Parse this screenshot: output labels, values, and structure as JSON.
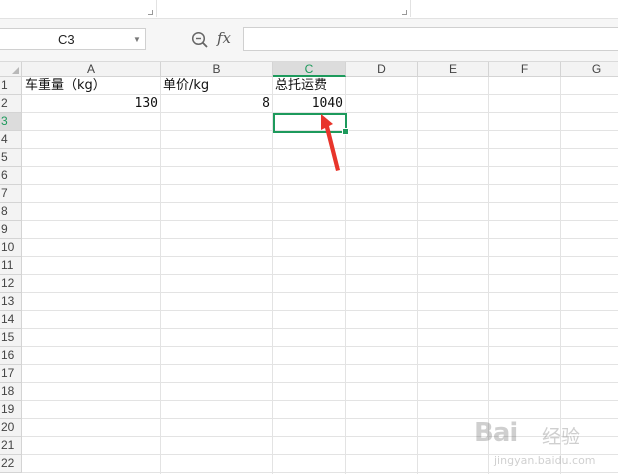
{
  "name_box": {
    "value": "C3"
  },
  "formula_bar": {
    "fx_label": "fx",
    "content": ""
  },
  "columns": [
    "A",
    "B",
    "C",
    "D",
    "E",
    "F",
    "G"
  ],
  "active_column": "C",
  "rows": [
    "1",
    "2",
    "3",
    "4",
    "5",
    "6",
    "7",
    "8",
    "9",
    "10",
    "11",
    "12",
    "13",
    "14",
    "15",
    "16",
    "17",
    "18",
    "19",
    "20",
    "21",
    "22"
  ],
  "active_row": "3",
  "cells": {
    "A1": "车重量（kg）",
    "B1": "单价/kg",
    "C1": "总托运费",
    "A2": "130",
    "B2": "8",
    "C2": "1040"
  },
  "colors": {
    "accent": "#1d9a5c",
    "arrow": "#e8352b"
  },
  "watermark": {
    "brand": "Bai",
    "sub": "经验",
    "url": "jingyan.baidu.com"
  }
}
